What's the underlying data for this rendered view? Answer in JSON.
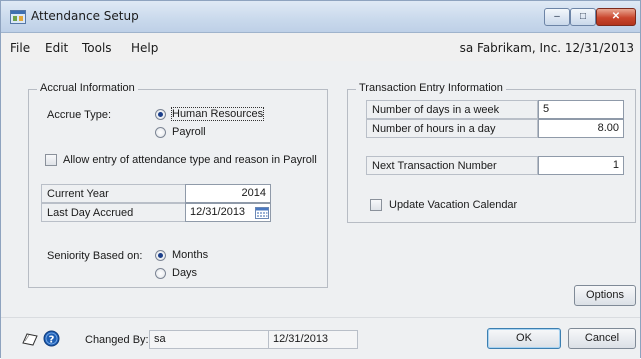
{
  "window": {
    "title": "Attendance Setup",
    "controls": {
      "minimize": "–",
      "maximize": "□",
      "close": "✕"
    }
  },
  "menu": {
    "items": [
      "File",
      "Edit",
      "Tools",
      "Help"
    ],
    "company_info": "sa  Fabrikam, Inc.  12/31/2013"
  },
  "accrual": {
    "legend": "Accrual Information",
    "accrue_type_label": "Accrue Type:",
    "options": [
      {
        "label": "Human Resources",
        "selected": true
      },
      {
        "label": "Payroll",
        "selected": false
      }
    ],
    "allow_entry_label": "Allow entry of attendance type and reason in Payroll",
    "allow_entry_checked": false,
    "current_year_label": "Current Year",
    "current_year_value": "2014",
    "last_day_label": "Last Day Accrued",
    "last_day_value": "12/31/2013",
    "seniority_label": "Seniority Based on:",
    "seniority_options": [
      {
        "label": "Months",
        "selected": true
      },
      {
        "label": "Days",
        "selected": false
      }
    ]
  },
  "transaction": {
    "legend": "Transaction Entry Information",
    "days_label": "Number of days in a week",
    "days_value": "5",
    "hours_label": "Number of hours in a day",
    "hours_value": "8.00",
    "next_label": "Next Transaction Number",
    "next_value": "1",
    "vacation_label": "Update Vacation Calendar",
    "vacation_checked": false
  },
  "buttons": {
    "options": "Options",
    "ok": "OK",
    "cancel": "Cancel"
  },
  "footer": {
    "changed_by_label": "Changed By:",
    "changed_by_value": "sa",
    "changed_date": "12/31/2013"
  },
  "colors": {
    "title_gradient_top": "#dfe9f5",
    "close_button": "#c9462d",
    "help_icon": "#1f5fb4",
    "radio_dot": "#1b3f8a"
  }
}
